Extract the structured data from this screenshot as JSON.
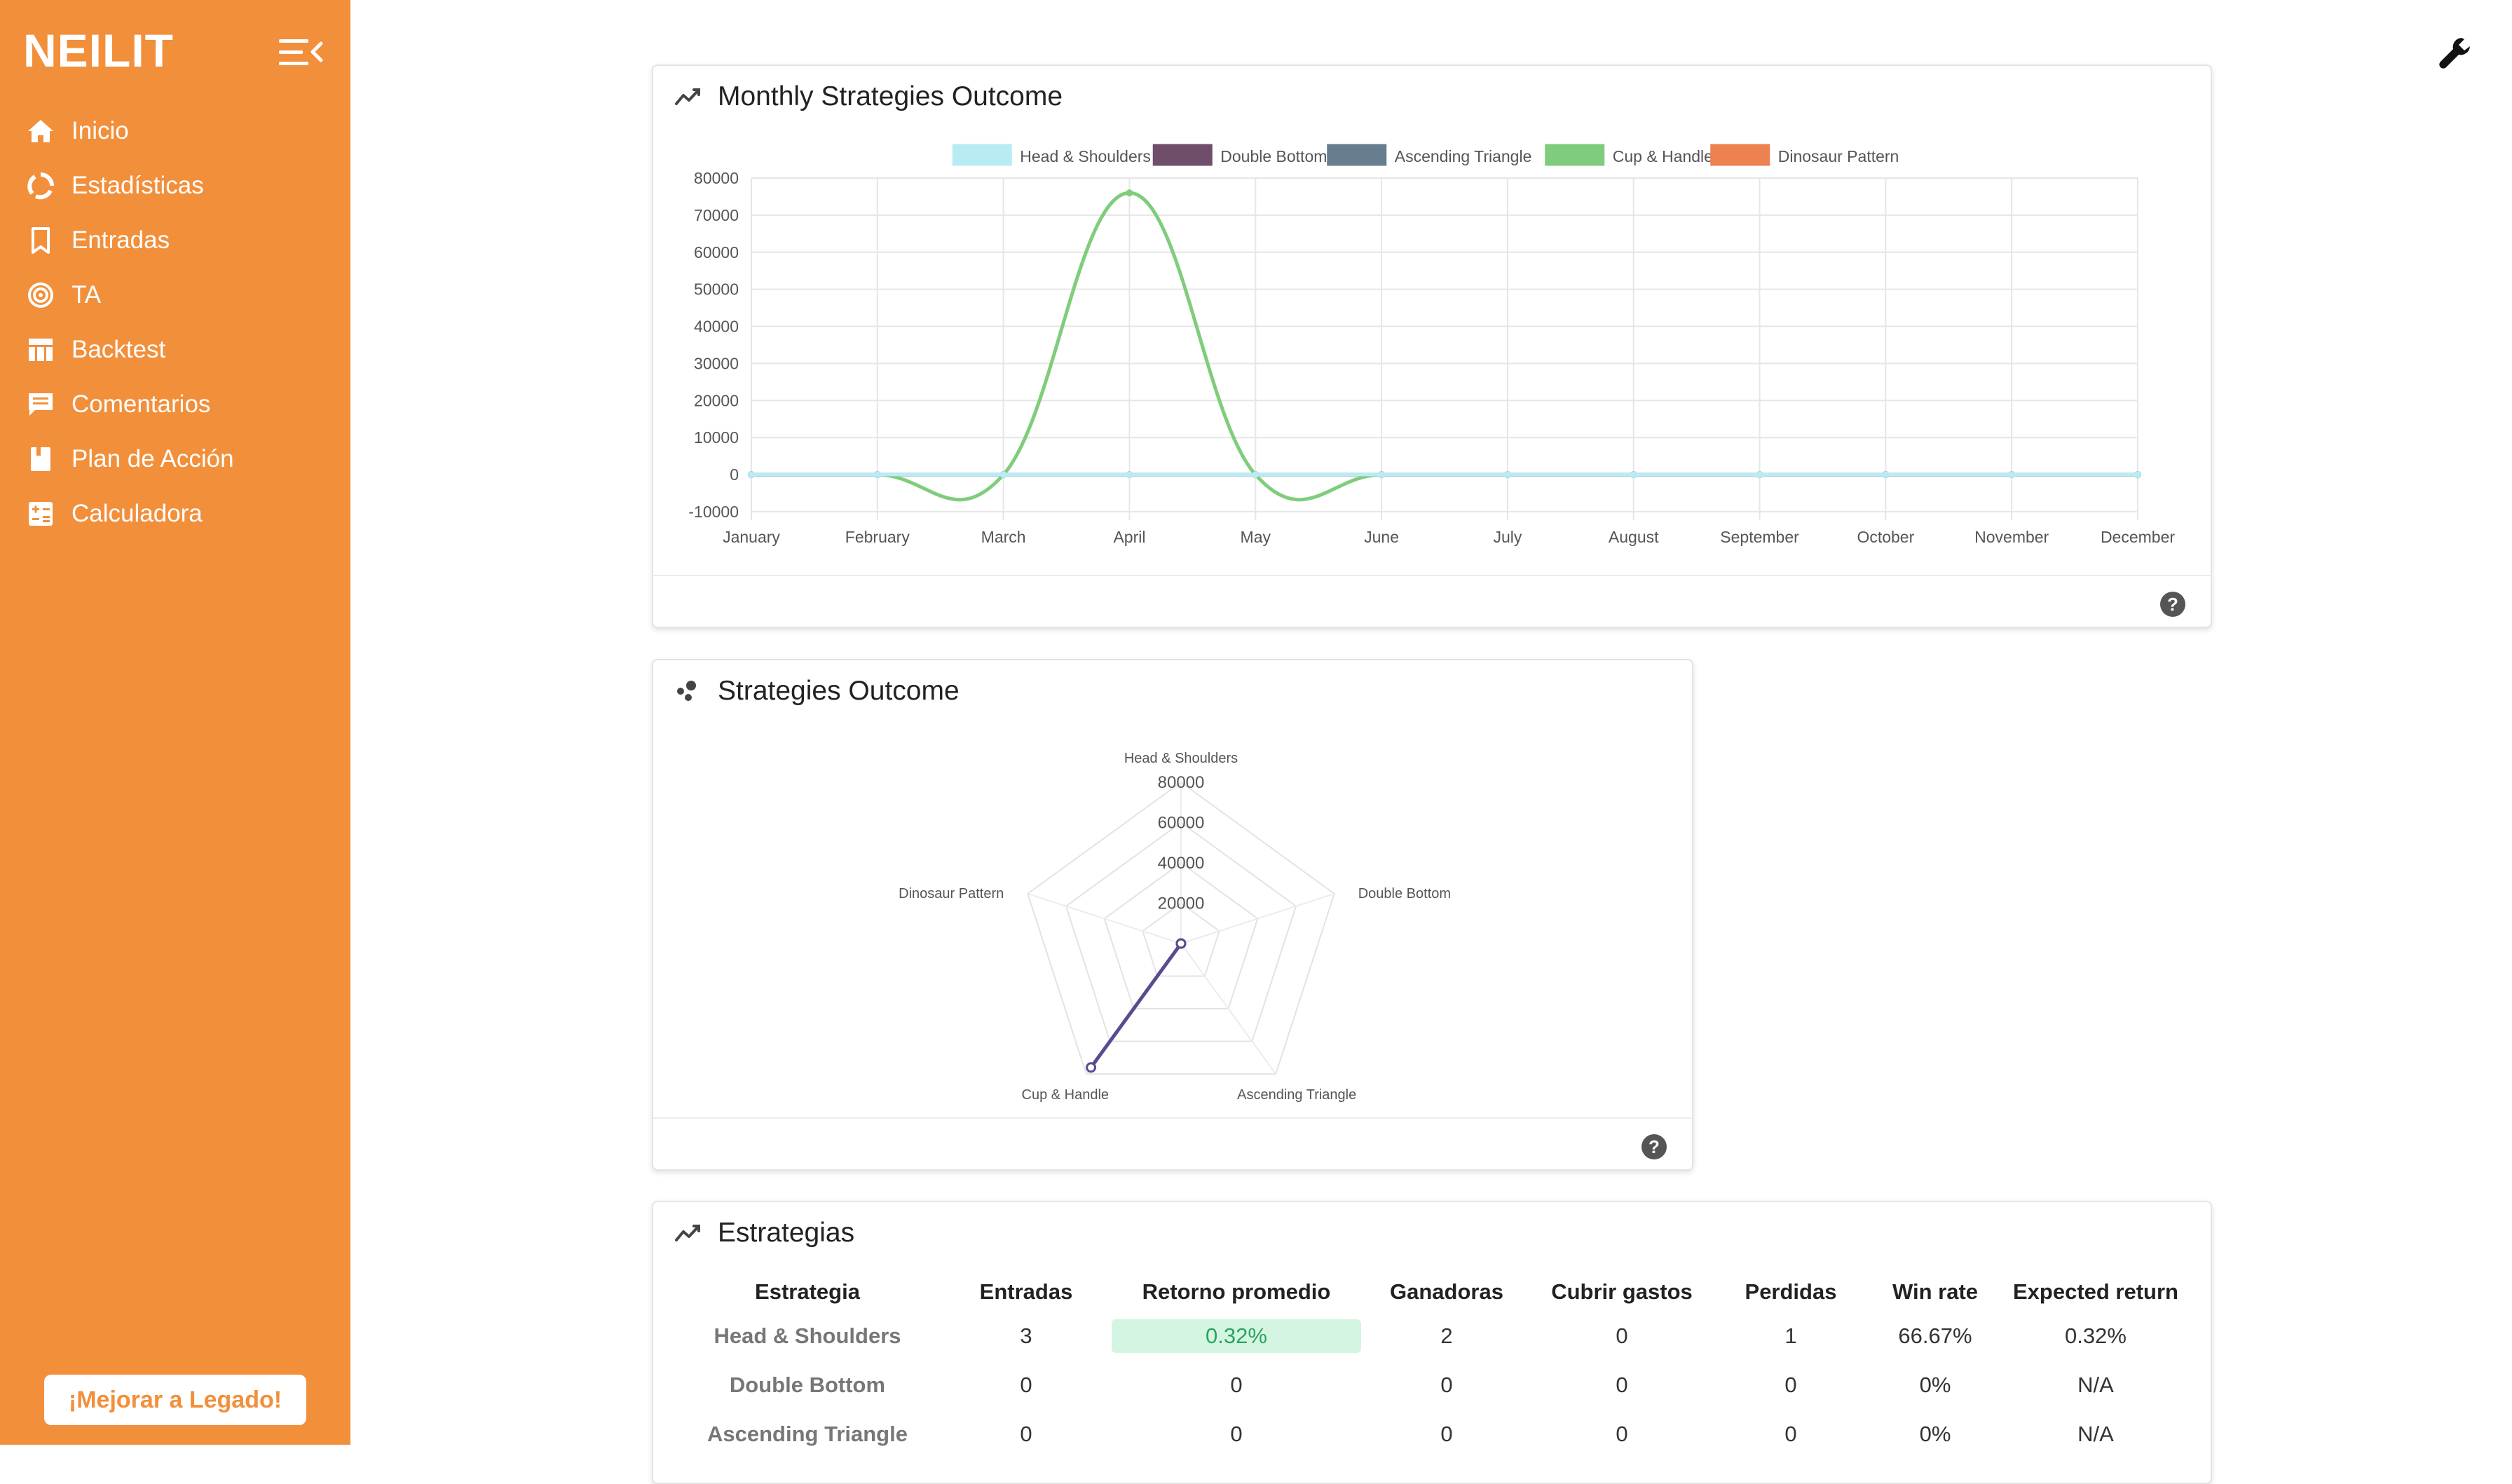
{
  "brand": "NEILIT",
  "sidebar": {
    "items": [
      {
        "label": "Inicio",
        "icon": "home-icon"
      },
      {
        "label": "Estadísticas",
        "icon": "spinner-icon"
      },
      {
        "label": "Entradas",
        "icon": "bookmark-icon"
      },
      {
        "label": "TA",
        "icon": "target-icon"
      },
      {
        "label": "Backtest",
        "icon": "table-icon"
      },
      {
        "label": "Comentarios",
        "icon": "comment-icon"
      },
      {
        "label": "Plan de Acción",
        "icon": "book-icon"
      },
      {
        "label": "Calculadora",
        "icon": "calculator-icon"
      }
    ],
    "upgrade_label": "¡Mejorar a Legado!"
  },
  "colors": {
    "accent": "#f28f3b",
    "head_shoulders": "#b8ecf4",
    "double_bottom": "#6e4e6a",
    "ascending_triangle": "#667e8f",
    "cup_handle": "#7fcd7c",
    "dinosaur_pattern": "#ee8150",
    "radar_line": "#5b4a8f"
  },
  "monthly": {
    "title": "Monthly Strategies Outcome",
    "help": "?"
  },
  "radar": {
    "title": "Strategies Outcome",
    "help": "?"
  },
  "table": {
    "title": "Estrategias",
    "headers": [
      "Estrategia",
      "Entradas",
      "Retorno promedio",
      "Ganadoras",
      "Cubrir gastos",
      "Perdidas",
      "Win rate",
      "Expected return"
    ],
    "rows": [
      [
        "Head & Shoulders",
        "3",
        "0.32%",
        "2",
        "0",
        "1",
        "66.67%",
        "0.32%"
      ],
      [
        "Double Bottom",
        "0",
        "0",
        "0",
        "0",
        "0",
        "0%",
        "N/A"
      ],
      [
        "Ascending Triangle",
        "0",
        "0",
        "0",
        "0",
        "0",
        "0%",
        "N/A"
      ]
    ]
  },
  "chart_data": [
    {
      "type": "line",
      "categories": [
        "January",
        "February",
        "March",
        "April",
        "May",
        "June",
        "July",
        "August",
        "September",
        "October",
        "November",
        "December"
      ],
      "series": [
        {
          "name": "Head & Shoulders",
          "values": [
            0,
            0,
            0,
            0,
            0,
            0,
            0,
            0,
            0,
            0,
            0,
            0
          ]
        },
        {
          "name": "Double Bottom",
          "values": [
            0,
            0,
            0,
            0,
            0,
            0,
            0,
            0,
            0,
            0,
            0,
            0
          ]
        },
        {
          "name": "Ascending Triangle",
          "values": [
            0,
            0,
            0,
            0,
            0,
            0,
            0,
            0,
            0,
            0,
            0,
            0
          ]
        },
        {
          "name": "Cup & Handle",
          "values": [
            0,
            0,
            0,
            76000,
            0,
            0,
            0,
            0,
            0,
            0,
            0,
            0
          ]
        },
        {
          "name": "Dinosaur Pattern",
          "values": [
            0,
            0,
            0,
            0,
            0,
            0,
            0,
            0,
            0,
            0,
            0,
            0
          ]
        }
      ],
      "yticks": [
        80000,
        70000,
        60000,
        50000,
        40000,
        30000,
        20000,
        10000,
        0,
        -10000
      ],
      "ylim": [
        -10000,
        80000
      ],
      "legend": "top",
      "grid": true
    },
    {
      "type": "radar",
      "labels": [
        "Head & Shoulders",
        "Double Bottom",
        "Ascending Triangle",
        "Cup & Handle",
        "Dinosaur Pattern"
      ],
      "values": [
        0,
        0,
        0,
        76000,
        0
      ],
      "ticks": [
        20000,
        40000,
        60000,
        80000
      ],
      "rmax": 80000,
      "grid": true
    }
  ]
}
